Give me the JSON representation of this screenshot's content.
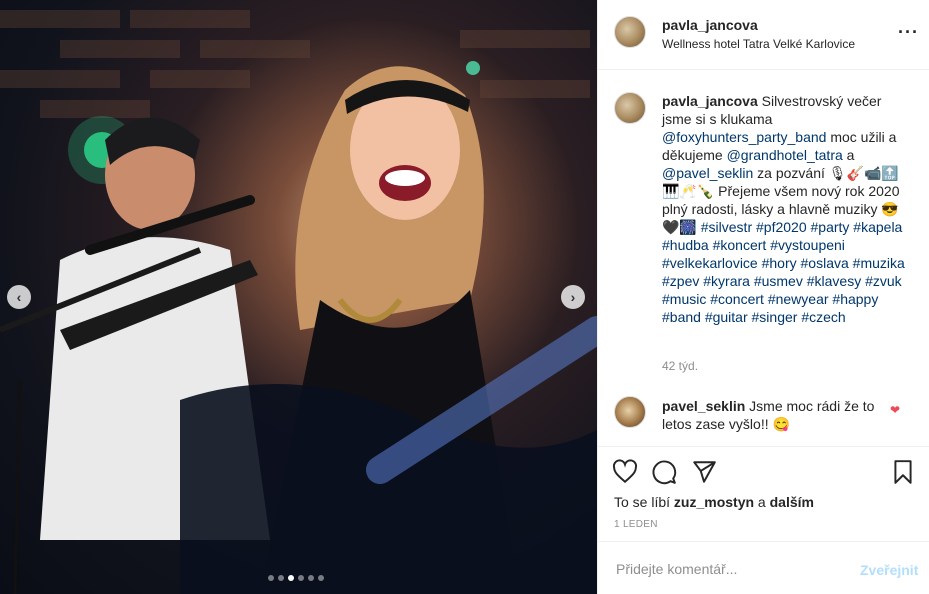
{
  "post": {
    "user": "pavla_jancova",
    "location": "Wellness hotel Tatra Velké Karlovice"
  },
  "caption": {
    "user": "pavla_jancova",
    "seg1": " Silvestrovský večer jsme si s klukama ",
    "mention1": "@foxyhunters_party_band",
    "seg2": " moc užili a děkujeme ",
    "mention2": "@grandhotel_tatra",
    "seg3": " a ",
    "mention3": "@pavel_seklin",
    "seg4": " za pozvání 🎙🎸📹🔝🎹🥂🍾 Přejeme všem nový rok 2020 plný radosti, lásky a hlavně muziky 😎🖤🎆 ",
    "hashtags": "#silvestr #pf2020 #party #kapela #hudba #koncert #vystoupeni #velkekarlovice #hory #oslava #muzika #zpev #kyrara #usmev #klavesy #zvuk #music #concert #newyear #happy #band #guitar #singer #czech",
    "age": "42 týd."
  },
  "reply": {
    "user": "pavel_seklin",
    "text": " Jsme moc rádi že to letos zase vyšlo!! 😋"
  },
  "likes": {
    "prefix": "To se líbí ",
    "user": "zuz_mostyn",
    "middle": " a ",
    "others": "dalším"
  },
  "date": "1 LEDEN",
  "comment_input": {
    "placeholder": "Přidejte komentář..."
  },
  "publish_label": "Zveřejnit",
  "carousel": {
    "total": 6,
    "current": 3
  },
  "colors": {
    "link": "#00376b",
    "publish_disabled": "#b2dffc",
    "heart": "#ed4956"
  },
  "icons": [
    "chevron-left-icon",
    "chevron-right-icon",
    "more-icon",
    "heart-icon",
    "comment-icon",
    "share-icon",
    "bookmark-icon"
  ]
}
